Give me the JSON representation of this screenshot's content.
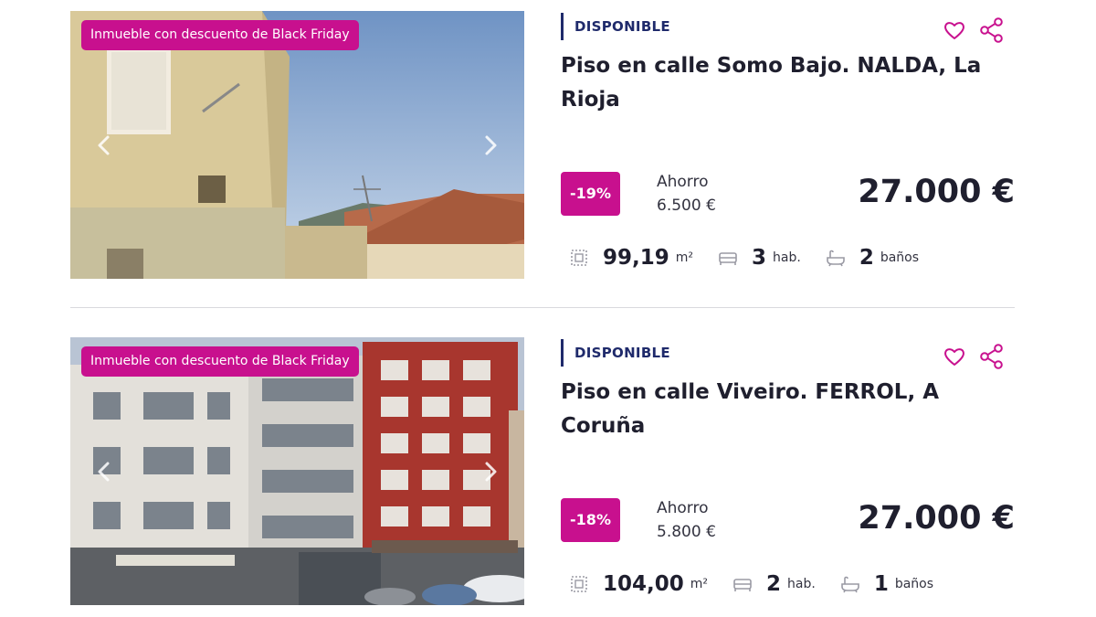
{
  "listings": [
    {
      "badge": "Inmueble con descuento de Black Friday",
      "status": "DISPONIBLE",
      "title": "Piso en calle Somo Bajo. NALDA, La Rioja",
      "discount": "-19%",
      "saving_label": "Ahorro",
      "saving_value": "6.500 €",
      "price": "27.000 €",
      "area_value": "99,19",
      "area_unit": "m²",
      "rooms_value": "3",
      "rooms_unit": "hab.",
      "baths_value": "2",
      "baths_unit": "baños"
    },
    {
      "badge": "Inmueble con descuento de Black Friday",
      "status": "DISPONIBLE",
      "title": "Piso en calle Viveiro. FERROL, A Coruña",
      "discount": "-18%",
      "saving_label": "Ahorro",
      "saving_value": "5.800 €",
      "price": "27.000 €",
      "area_value": "104,00",
      "area_unit": "m²",
      "rooms_value": "2",
      "rooms_unit": "hab.",
      "baths_value": "1",
      "baths_unit": "baños"
    }
  ],
  "icons": {
    "favorite": "heart-icon",
    "share": "share-icon",
    "prev": "chevron-left-icon",
    "next": "chevron-right-icon",
    "area": "area-icon",
    "rooms": "bed-icon",
    "baths": "bathtub-icon"
  },
  "colors": {
    "accent": "#c8108e",
    "status": "#1f2a6b",
    "text": "#1f1f2e"
  }
}
